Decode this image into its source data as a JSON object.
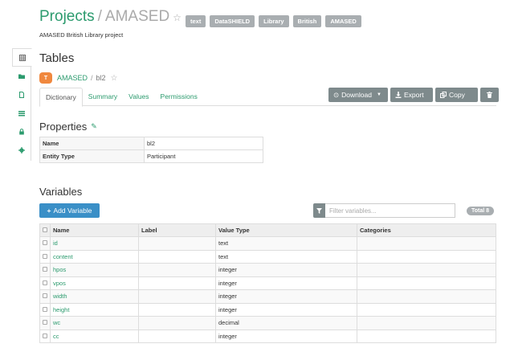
{
  "header": {
    "title": "Projects",
    "separator": "/",
    "project": "AMASED",
    "tags": [
      "text",
      "DataSHIELD",
      "Library",
      "British",
      "AMASED"
    ],
    "subtitle": "AMASED British Library project"
  },
  "sidebar": {
    "icons": [
      "table-icon",
      "folder-icon",
      "file-icon",
      "list-icon",
      "lock-icon",
      "gear-icon"
    ]
  },
  "tables": {
    "heading": "Tables",
    "badge": "T",
    "project_link": "AMASED",
    "separator": "/",
    "table_name": "bl2"
  },
  "tabs": [
    "Dictionary",
    "Summary",
    "Values",
    "Permissions"
  ],
  "toolbar": {
    "download": "Download",
    "export": "Export",
    "copy": "Copy"
  },
  "properties": {
    "heading": "Properties",
    "rows": [
      {
        "key": "Name",
        "value": "bl2"
      },
      {
        "key": "Entity Type",
        "value": "Participant"
      }
    ]
  },
  "variables": {
    "heading": "Variables",
    "add_label": "Add Variable",
    "filter_placeholder": "Filter variables...",
    "total": "Total 8",
    "columns": [
      "Name",
      "Label",
      "Value Type",
      "Categories"
    ],
    "rows": [
      {
        "name": "id",
        "label": "",
        "type": "text",
        "categories": ""
      },
      {
        "name": "content",
        "label": "",
        "type": "text",
        "categories": ""
      },
      {
        "name": "hpos",
        "label": "",
        "type": "integer",
        "categories": ""
      },
      {
        "name": "vpos",
        "label": "",
        "type": "integer",
        "categories": ""
      },
      {
        "name": "width",
        "label": "",
        "type": "integer",
        "categories": ""
      },
      {
        "name": "height",
        "label": "",
        "type": "integer",
        "categories": ""
      },
      {
        "name": "wc",
        "label": "",
        "type": "decimal",
        "categories": ""
      },
      {
        "name": "cc",
        "label": "",
        "type": "integer",
        "categories": ""
      }
    ]
  }
}
